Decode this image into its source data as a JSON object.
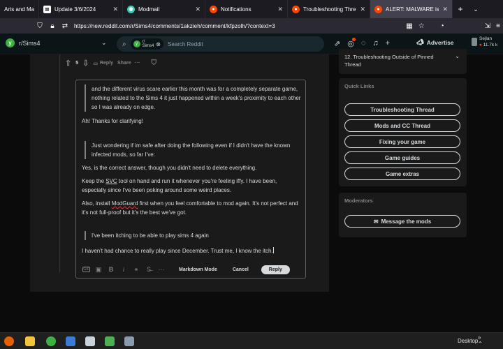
{
  "browser": {
    "tabs": [
      {
        "title": "Arts and Mas",
        "favicon": "none",
        "active": false
      },
      {
        "title": "Update 3/6/2024",
        "favicon": "page-icon",
        "active": false
      },
      {
        "title": "Modmail",
        "favicon": "modmail-icon",
        "active": false
      },
      {
        "title": "Notifications",
        "favicon": "reddit-icon",
        "active": false
      },
      {
        "title": "Troubleshooting Thread --",
        "favicon": "reddit-icon",
        "active": false
      },
      {
        "title": "ALERT: MALWARE is being",
        "favicon": "reddit-icon",
        "active": true
      }
    ],
    "url": "https://new.reddit.com/r/Sims4/comments/1akzieh/comment/kfpzolh/?context=3"
  },
  "reddit_header": {
    "subreddit": "r/Sims4",
    "search_chip_line1": "r/",
    "search_chip_line2": "Sims4",
    "search_placeholder": "Search Reddit",
    "advertise_label": "Advertise",
    "username": "Sejlan",
    "karma": "11.7k k"
  },
  "comment_actions": {
    "score": "5",
    "reply_label": "Reply",
    "share_label": "Share",
    "more_label": "···"
  },
  "editor": {
    "quote1": "and the different virus scare earlier this month was for a completely separate game, nothing related to the Sims 4 it just happened within a week's proximity to each other so I was already on edge.",
    "para1": "Ah! Thanks for clarifying!",
    "quote2": "Just wondering if im safe after doing the following even if I didn't have the known infected mods, so far I've:",
    "para2": "Yes, is the correct answer, though you didn't need to delete everything.",
    "para3_a": "Keep the ",
    "para3_link": "SVC",
    "para3_b": " tool on hand and run it whenever you're feeling iffy. I have been, especially since I've been poking around some weird places.",
    "para4_a": "Also, install ",
    "para4_link": "ModGuard",
    "para4_b": " first when you feel comfortable to mod again. It's not perfect and it's not full-proof but it's the best we've got.",
    "quote3": "I've been itching to be able to play sims 4 again",
    "para5": "I haven't had chance to really play since December. Trust me, I know the itch.",
    "toolbar": {
      "gif_label": "GIF",
      "markdown_label": "Markdown Mode",
      "cancel_label": "Cancel",
      "reply_label": "Reply"
    }
  },
  "sidebar": {
    "rule_item": "12. Troubleshooting Outside of Pinned Thread",
    "quick_links_title": "Quick Links",
    "quick_links": [
      "Troubleshooting Thread",
      "Mods and CC Thread",
      "Fixing your game",
      "Game guides",
      "Game extras"
    ],
    "moderators_title": "Moderators",
    "message_mods_label": "Message the mods"
  },
  "taskbar": {
    "desktop_label": "Desktop"
  },
  "colors": {
    "accent": "#ff4500",
    "background": "#0b0b0b",
    "panel": "#1a1a1b",
    "text": "#d7dadc",
    "subreddit_icon": "#3db041"
  }
}
